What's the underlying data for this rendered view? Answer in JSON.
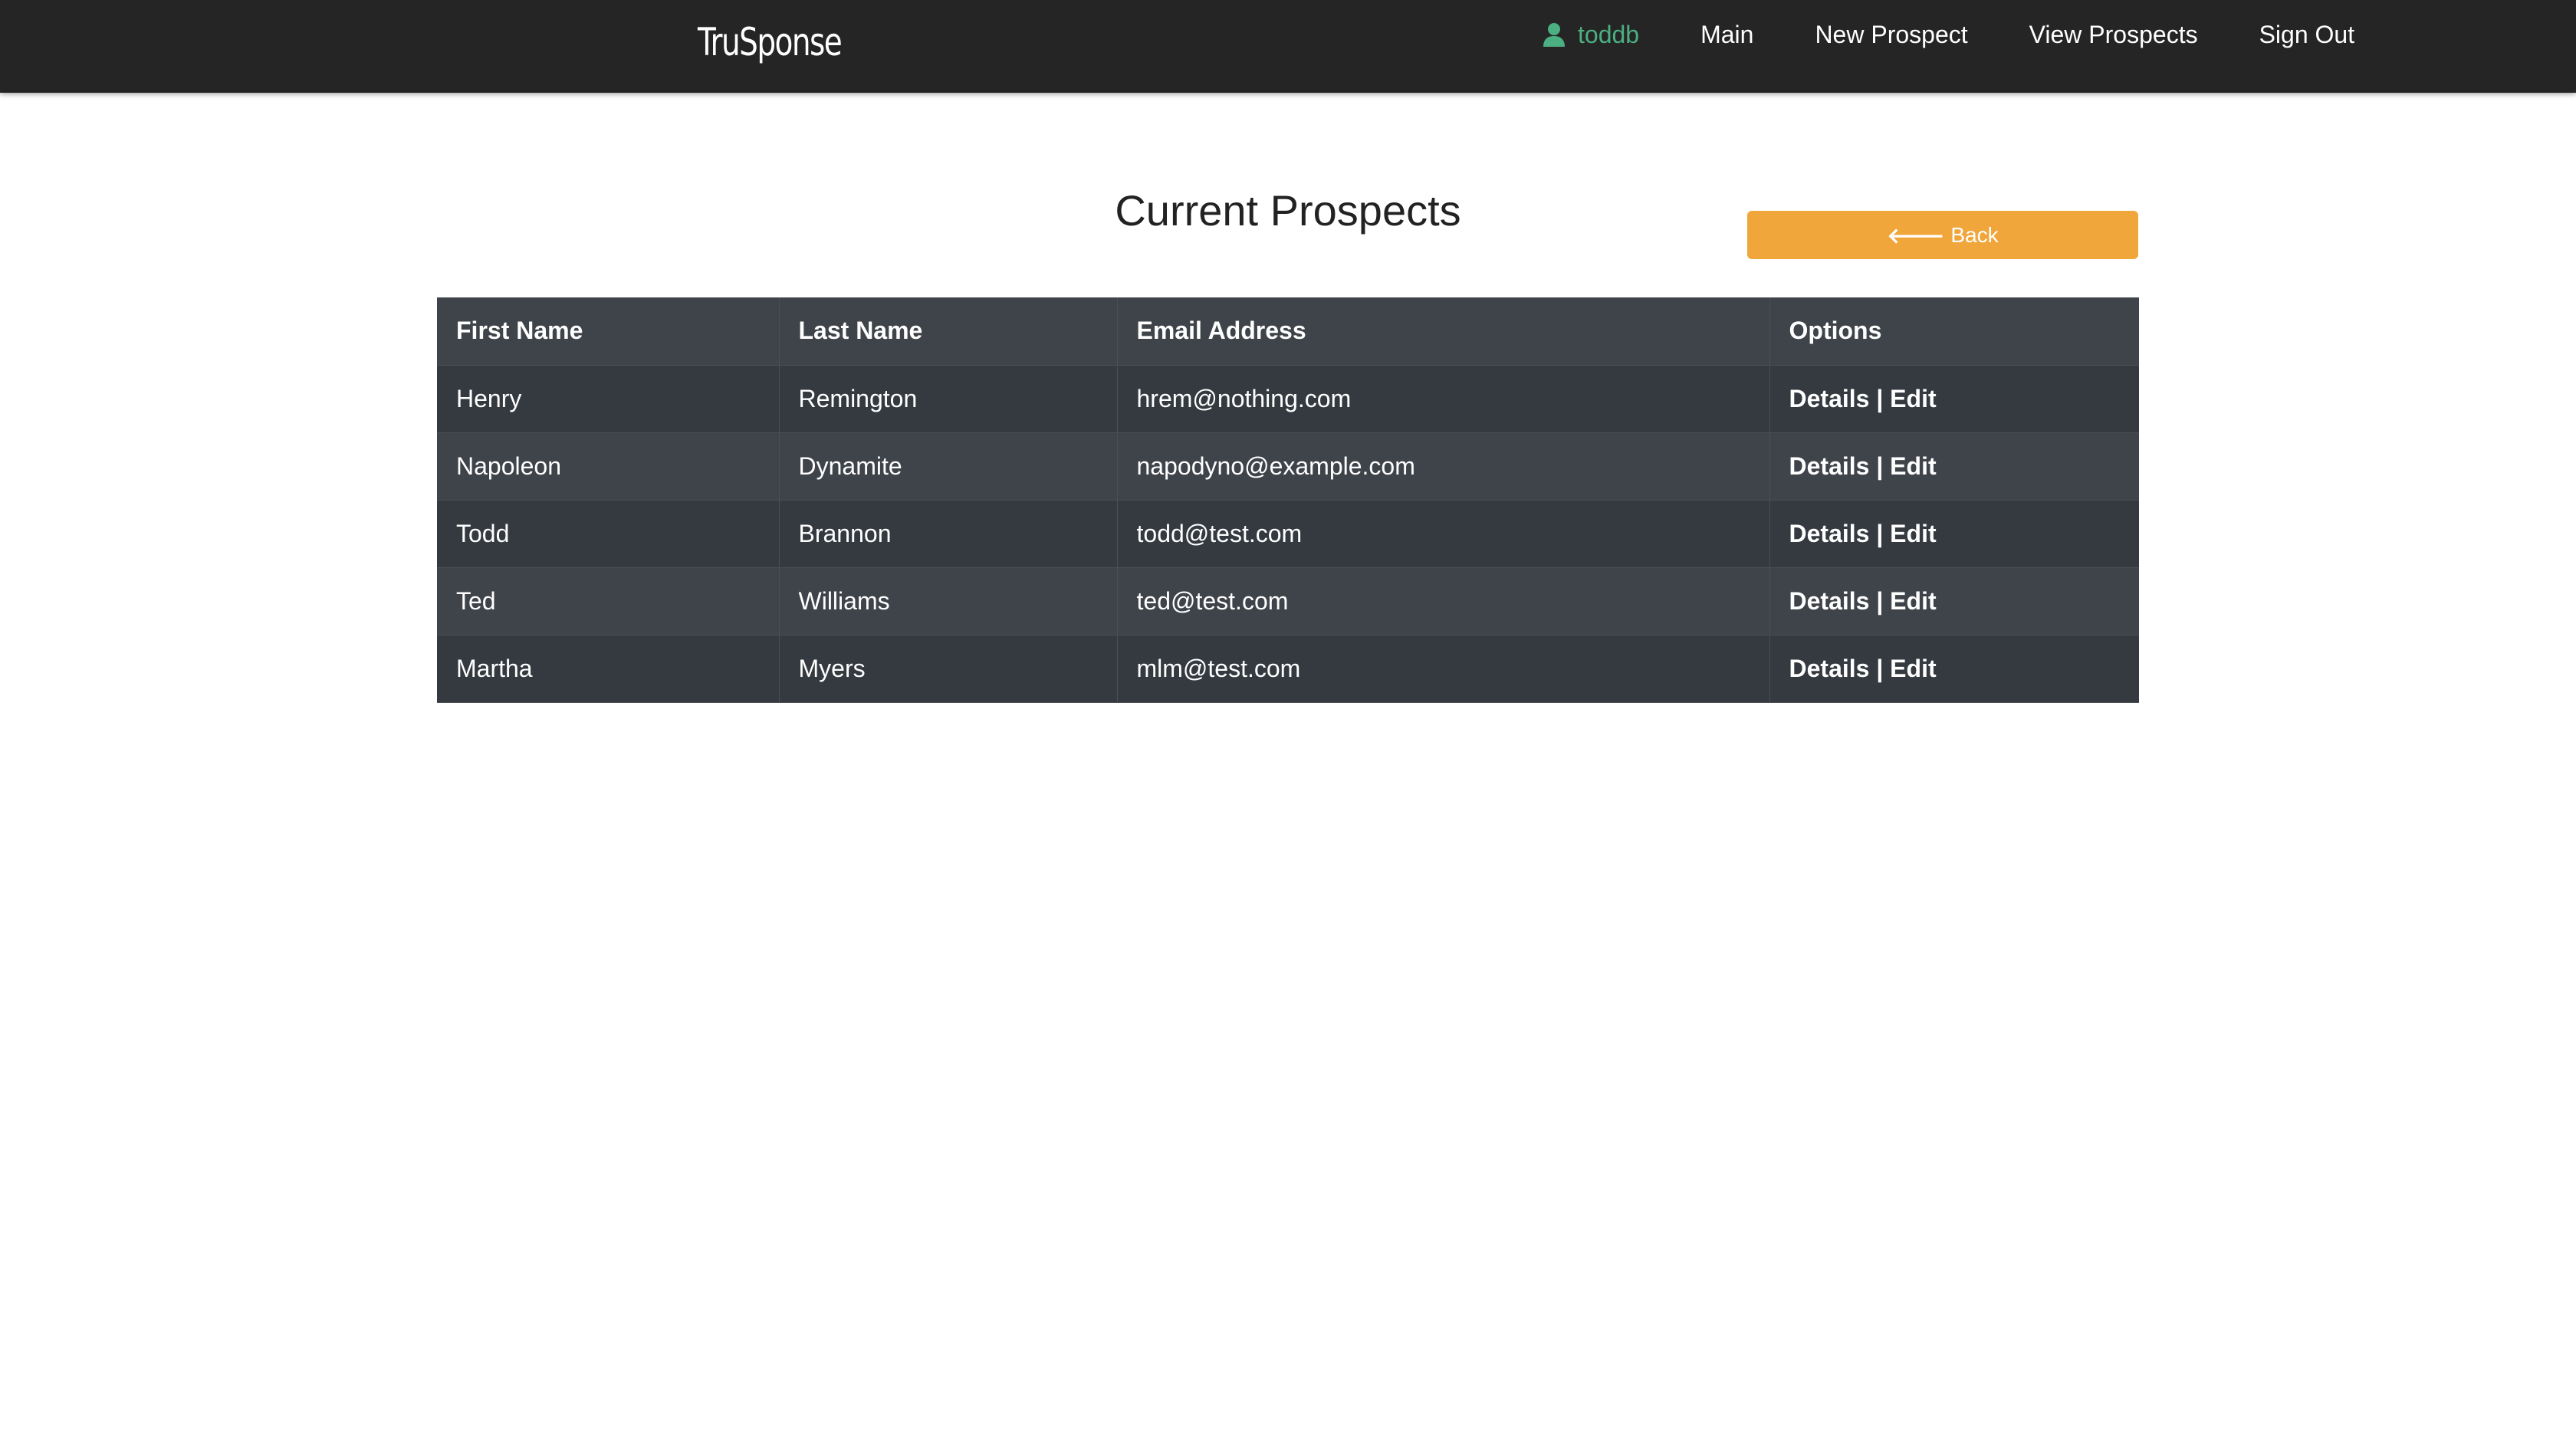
{
  "navbar": {
    "brand": "TruSponse",
    "user": {
      "icon": "user-icon",
      "name": "toddb",
      "color": "#4caf82"
    },
    "links": [
      "Main",
      "New Prospect",
      "View Prospects",
      "Sign Out"
    ]
  },
  "page": {
    "title": "Current Prospects",
    "back_button": {
      "icon": "arrow-left-icon",
      "label": "Back",
      "color": "#f0a63b"
    }
  },
  "table": {
    "headers": [
      "First Name",
      "Last Name",
      "Email Address",
      "Options"
    ],
    "rows": [
      {
        "first": "Henry",
        "last": "Remington",
        "email": "hrem@nothing.com"
      },
      {
        "first": "Napoleon",
        "last": "Dynamite",
        "email": "napodyno@example.com"
      },
      {
        "first": "Todd",
        "last": "Brannon",
        "email": "todd@test.com"
      },
      {
        "first": "Ted",
        "last": "Williams",
        "email": "ted@test.com"
      },
      {
        "first": "Martha",
        "last": "Myers",
        "email": "mlm@test.com"
      }
    ],
    "options": {
      "details": "Details",
      "separator": "|",
      "edit": "Edit"
    }
  }
}
